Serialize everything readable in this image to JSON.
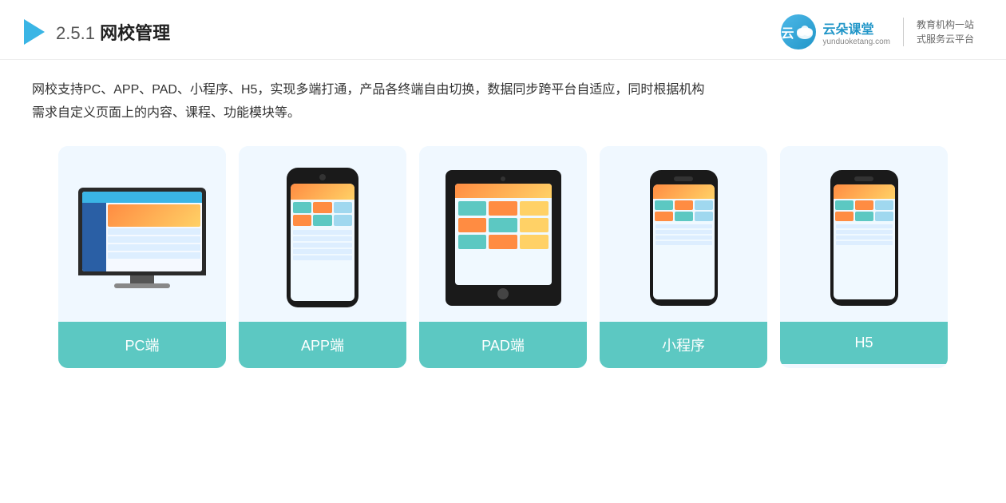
{
  "header": {
    "section_number": "2.5.1",
    "section_title": "网校管理",
    "brand": {
      "icon_text": "云朵课堂",
      "name": "云朵课堂",
      "url": "yunduoketang.com",
      "slogan_line1": "教育机构一站",
      "slogan_line2": "式服务云平台"
    }
  },
  "description": {
    "text_line1": "网校支持PC、APP、PAD、小程序、H5，实现多端打通，产品各终端自由切换，数据同步跨平台自适应，同时根据机构",
    "text_line2": "需求自定义页面上的内容、课程、功能模块等。"
  },
  "cards": [
    {
      "id": "pc",
      "label": "PC端",
      "device_type": "pc"
    },
    {
      "id": "app",
      "label": "APP端",
      "device_type": "phone"
    },
    {
      "id": "pad",
      "label": "PAD端",
      "device_type": "pad"
    },
    {
      "id": "miniprogram",
      "label": "小程序",
      "device_type": "phone_notch"
    },
    {
      "id": "h5",
      "label": "H5",
      "device_type": "phone_notch2"
    }
  ],
  "colors": {
    "accent": "#5cc8c2",
    "blue": "#3ab5e5",
    "dark_blue": "#2196c8",
    "orange": "#ff8c42"
  }
}
